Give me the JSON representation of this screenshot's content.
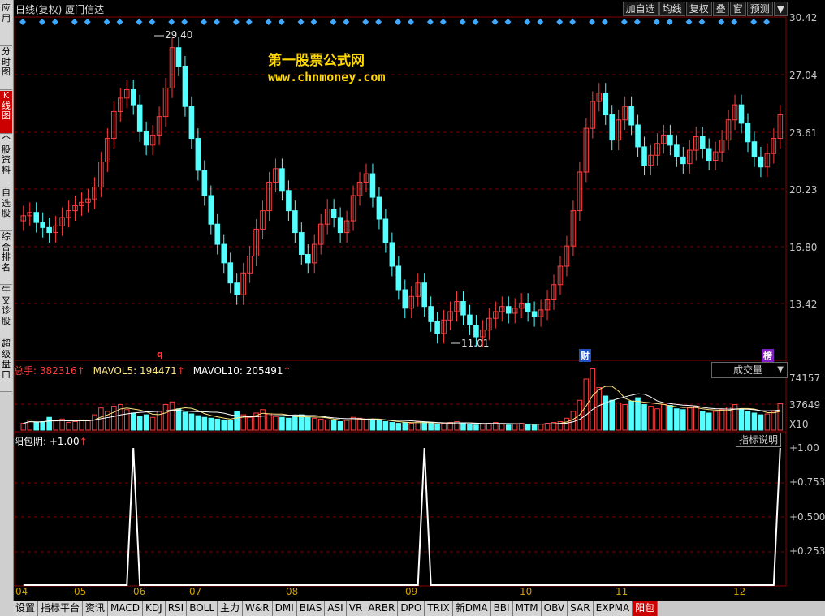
{
  "window": {
    "title": "日线(复权) 厦门信达"
  },
  "sidebar": {
    "items": [
      "应用",
      "分时图",
      "K线图",
      "个股资料",
      "自选股",
      "综合排名",
      "牛叉诊股",
      "超级盘口"
    ],
    "active_index": 2
  },
  "toolbar": {
    "buttons": [
      "加自选",
      "均线",
      "复权",
      "叠",
      "窗",
      "预测"
    ],
    "more": "▼"
  },
  "watermark": {
    "line1": "第一股票公式网",
    "line2": "www.chnmoney.com"
  },
  "price_axis": {
    "labels": [
      "30.42",
      "27.04",
      "23.61",
      "20.23",
      "16.80",
      "13.42"
    ]
  },
  "price_annotations": {
    "high": "29.40",
    "low": "11.01"
  },
  "markers": {
    "q": "q",
    "cai": "财",
    "bang": "榜"
  },
  "volume_panel": {
    "total_label": "总手: 382316",
    "mavol5": "MAVOL5: 194471",
    "mavol10": "MAVOL10: 205491",
    "up_arrow": "↑",
    "dropdown_value": "成交量",
    "dropdown_arrow": "▼",
    "axis_labels": [
      "74157",
      "37649",
      "X10"
    ]
  },
  "indicator_panel": {
    "label": "阳包阴: +1.00",
    "up_arrow": "↑",
    "help_button": "指标说明",
    "axis_labels": [
      "+1.00",
      "+0.753",
      "+0.500",
      "+0.253"
    ]
  },
  "x_axis": {
    "months": [
      "04",
      "05",
      "06",
      "07",
      "08",
      "09",
      "10",
      "11",
      "12"
    ]
  },
  "tabs": {
    "items": [
      "设置",
      "指标平台",
      "资讯",
      "MACD",
      "KDJ",
      "RSI",
      "BOLL",
      "主力",
      "W&R",
      "DMI",
      "BIAS",
      "ASI",
      "VR",
      "ARBR",
      "DPO",
      "TRIX",
      "新DMA",
      "BBI",
      "MTM",
      "OBV",
      "SAR",
      "EXPMA",
      "阳包"
    ],
    "active_index": 22
  },
  "colors": {
    "up": "#ff3c3c",
    "down": "#54ffff",
    "grid": "#7a0000",
    "diamond": "#3fa8ff",
    "signal": "#ffffff",
    "accent": "#ffd800"
  },
  "chart_data": [
    {
      "type": "candlestick",
      "title": "日线(复权) 厦门信达",
      "x": [
        "04",
        "05",
        "06",
        "07",
        "08",
        "09",
        "10",
        "11",
        "12"
      ],
      "ylim": [
        10.0,
        30.42
      ],
      "annotations": [
        {
          "label": "29.40",
          "value": 29.4
        },
        {
          "label": "11.01",
          "value": 11.01
        }
      ],
      "series": [
        {
          "values": [
            18.6,
            18.8,
            18.2,
            17.9,
            17.6,
            18.0,
            18.5,
            18.9,
            19.2,
            19.4,
            19.6,
            20.3,
            21.8,
            23.2,
            24.8,
            25.6,
            26.1,
            25.2,
            23.6,
            22.8,
            23.4,
            24.5,
            26.2,
            28.6,
            27.5,
            25.1,
            23.2,
            21.3,
            19.8,
            18.1,
            16.9,
            15.8,
            14.6,
            13.9,
            15.2,
            16.2,
            17.8,
            18.9,
            20.6,
            21.4,
            20.1,
            18.9,
            17.6,
            16.3,
            15.8,
            16.9,
            18.1,
            19.0,
            18.5,
            17.6,
            18.3,
            19.8,
            20.6,
            21.1,
            19.7,
            18.4,
            17.0,
            15.6,
            14.2,
            13.1,
            13.8,
            14.6,
            13.2,
            12.3,
            11.6,
            12.4,
            12.9,
            13.5,
            12.7,
            12.1,
            11.4,
            11.8,
            12.5,
            12.9,
            13.2,
            12.8,
            13.1,
            13.4,
            12.9,
            12.6,
            13.0,
            13.6,
            14.5,
            15.6,
            16.8,
            18.9,
            21.2,
            23.8,
            25.4,
            25.9,
            24.6,
            23.1,
            24.3,
            25.1,
            24.0,
            22.7,
            21.6,
            22.2,
            22.9,
            23.4,
            22.8,
            22.1,
            21.7,
            22.5,
            23.3,
            22.6,
            21.9,
            22.4,
            23.1,
            24.3,
            25.2,
            24.1,
            23.0,
            22.1,
            21.5,
            22.3,
            23.2,
            24.6
          ]
        }
      ]
    },
    {
      "type": "bar",
      "title": "成交量",
      "ylabel": "X10",
      "ylim": [
        0,
        80000
      ],
      "series": [
        {
          "name": "总手",
          "values": [
            8000,
            12000,
            9000,
            10000,
            15000,
            11000,
            13000,
            9000,
            10000,
            12000,
            11000,
            18000,
            26000,
            22000,
            28000,
            30000,
            24000,
            20000,
            16000,
            18000,
            15000,
            22000,
            30000,
            33000,
            25000,
            21000,
            19000,
            17000,
            15000,
            14000,
            13000,
            12000,
            11000,
            22000,
            18000,
            15000,
            20000,
            24000,
            19000,
            16000,
            15000,
            14000,
            16000,
            18000,
            15000,
            14000,
            13000,
            12000,
            11000,
            10000,
            12000,
            15000,
            14000,
            13000,
            12000,
            11000,
            10000,
            9000,
            8000,
            9000,
            8000,
            10000,
            9000,
            8000,
            7000,
            8000,
            9000,
            10000,
            8000,
            7000,
            6000,
            7000,
            8000,
            9000,
            7000,
            6000,
            7000,
            8000,
            7000,
            6000,
            7000,
            8000,
            9000,
            10000,
            14000,
            22000,
            35000,
            60000,
            72000,
            50000,
            40000,
            35000,
            32000,
            30000,
            34000,
            38000,
            30000,
            28000,
            25000,
            30000,
            29000,
            25000,
            24000,
            26000,
            28000,
            22000,
            20000,
            22000,
            24000,
            27000,
            30000,
            24000,
            22000,
            20000,
            18000,
            19000,
            22000,
            31000
          ]
        },
        {
          "name": "MAVOL5",
          "values": [
            194471
          ]
        },
        {
          "name": "MAVOL10",
          "values": [
            205491
          ]
        }
      ]
    },
    {
      "type": "line",
      "title": "阳包阴",
      "ylim": [
        0,
        1.0
      ],
      "series": [
        {
          "name": "阳包阴",
          "values": [
            0,
            0,
            0,
            0,
            0,
            0,
            0,
            0,
            0,
            0,
            0,
            0,
            0,
            0,
            0,
            0,
            0,
            1,
            0,
            0,
            0,
            0,
            0,
            0,
            0,
            0,
            0,
            0,
            0,
            0,
            0,
            0,
            0,
            0,
            0,
            0,
            0,
            0,
            0,
            0,
            0,
            0,
            0,
            0,
            0,
            0,
            0,
            0,
            0,
            0,
            0,
            0,
            0,
            0,
            0,
            0,
            0,
            0,
            0,
            0,
            0,
            0,
            1,
            0,
            0,
            0,
            0,
            0,
            0,
            0,
            0,
            0,
            0,
            0,
            0,
            0,
            0,
            0,
            0,
            0,
            0,
            0,
            0,
            0,
            0,
            0,
            0,
            0,
            0,
            0,
            0,
            0,
            0,
            0,
            0,
            0,
            0,
            0,
            0,
            0,
            0,
            0,
            0,
            0,
            0,
            0,
            0,
            0,
            0,
            0,
            0,
            0,
            0,
            0,
            0,
            0,
            0,
            1
          ]
        }
      ]
    }
  ]
}
